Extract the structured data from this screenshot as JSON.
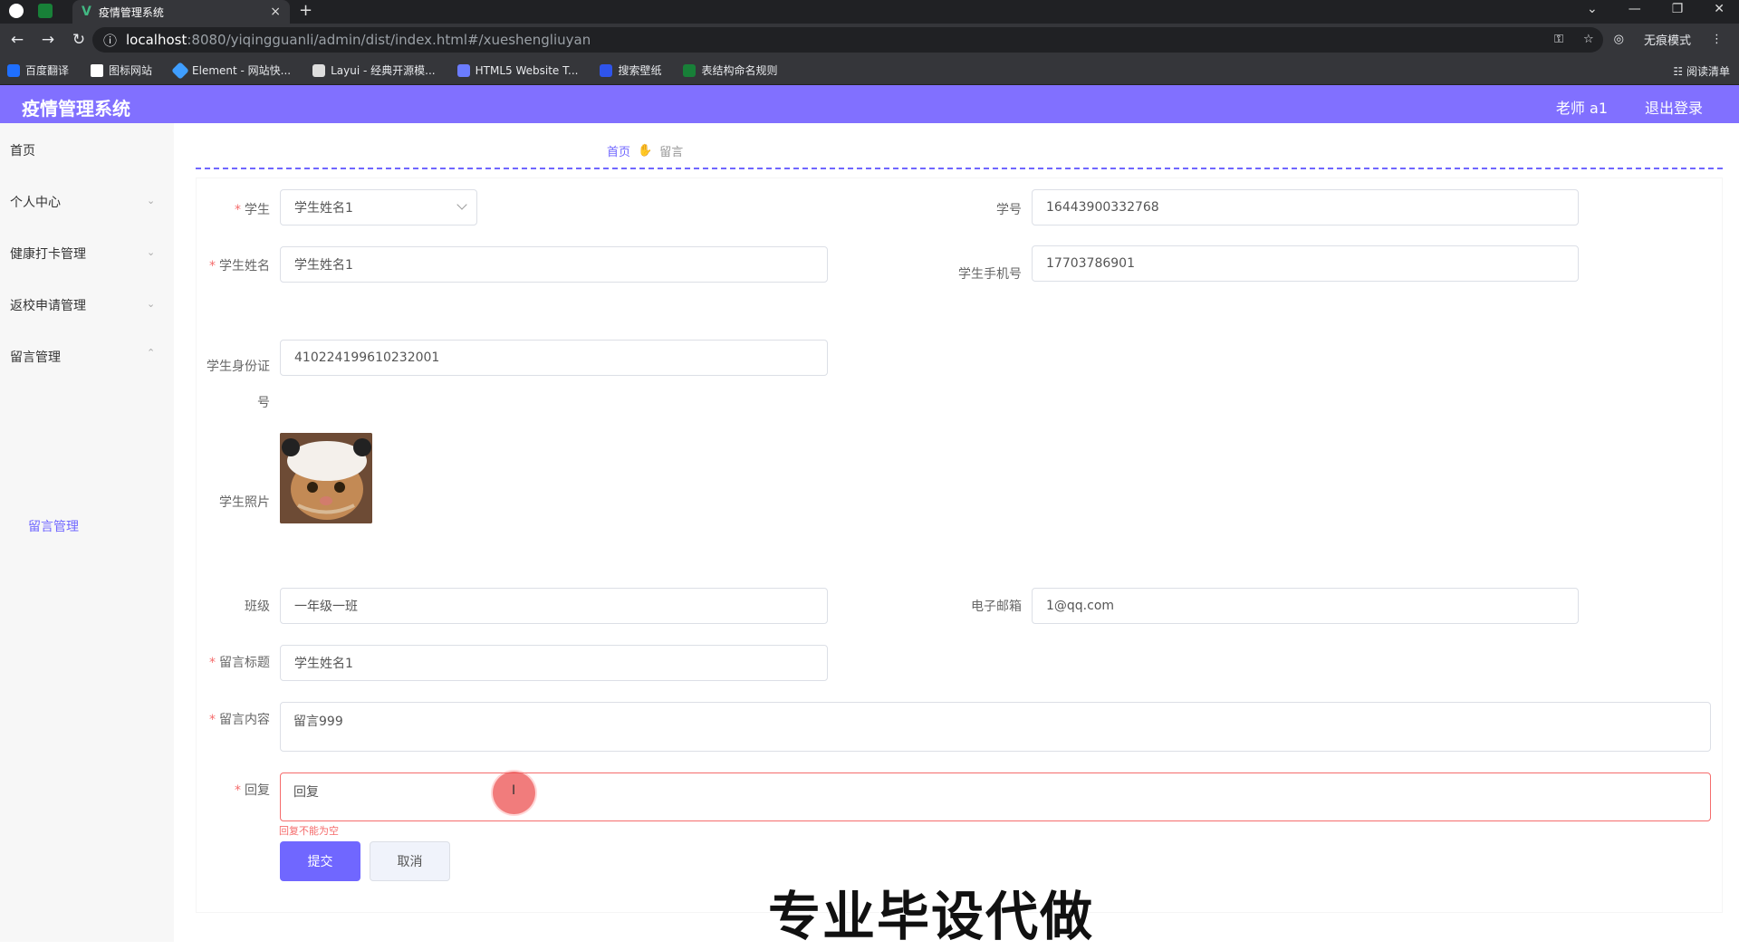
{
  "browser": {
    "tab_title": "疫情管理系统",
    "tab_close": "×",
    "new_tab": "+",
    "url_host": "localhost",
    "url_path": ":8080/yiqingguanli/admin/dist/index.html#/xueshengliuyan",
    "incognito_label": "无痕模式",
    "bookmarks": [
      "百度翻译",
      "图标网站",
      "Element - 网站快...",
      "Layui - 经典开源模...",
      "HTML5 Website T...",
      "搜索壁纸",
      "表结构命名规则"
    ],
    "reading_list": "阅读清单"
  },
  "header": {
    "title": "疫情管理系统",
    "user": "老师 a1",
    "logout": "退出登录"
  },
  "sidebar": {
    "items": [
      {
        "label": "首页"
      },
      {
        "label": "个人中心"
      },
      {
        "label": "健康打卡管理"
      },
      {
        "label": "返校申请管理"
      },
      {
        "label": "留言管理"
      }
    ],
    "submenu_label": "留言管理"
  },
  "breadcrumb": {
    "home": "首页",
    "current": "留言"
  },
  "form": {
    "student_label": "学生",
    "student_value": "学生姓名1",
    "student_no_label": "学号",
    "student_no_value": "16443900332768",
    "name_label": "学生姓名",
    "name_value": "学生姓名1",
    "phone_label": "学生手机号",
    "phone_value": "17703786901",
    "id_label": "学生身份证号",
    "id_value": "410224199610232001",
    "photo_label": "学生照片",
    "class_label": "班级",
    "class_value": "一年级一班",
    "email_label": "电子邮箱",
    "email_value": "1@qq.com",
    "title_label": "留言标题",
    "title_value": "学生姓名1",
    "content_label": "留言内容",
    "content_value": "留言999",
    "reply_label": "回复",
    "reply_value": "回复",
    "reply_error": "回复不能为空",
    "submit": "提交",
    "cancel": "取消"
  },
  "overlay": {
    "watermark": "专业毕设代做"
  },
  "colors": {
    "accent": "#7067ff",
    "header": "#8170ff",
    "error": "#f56c6c"
  }
}
